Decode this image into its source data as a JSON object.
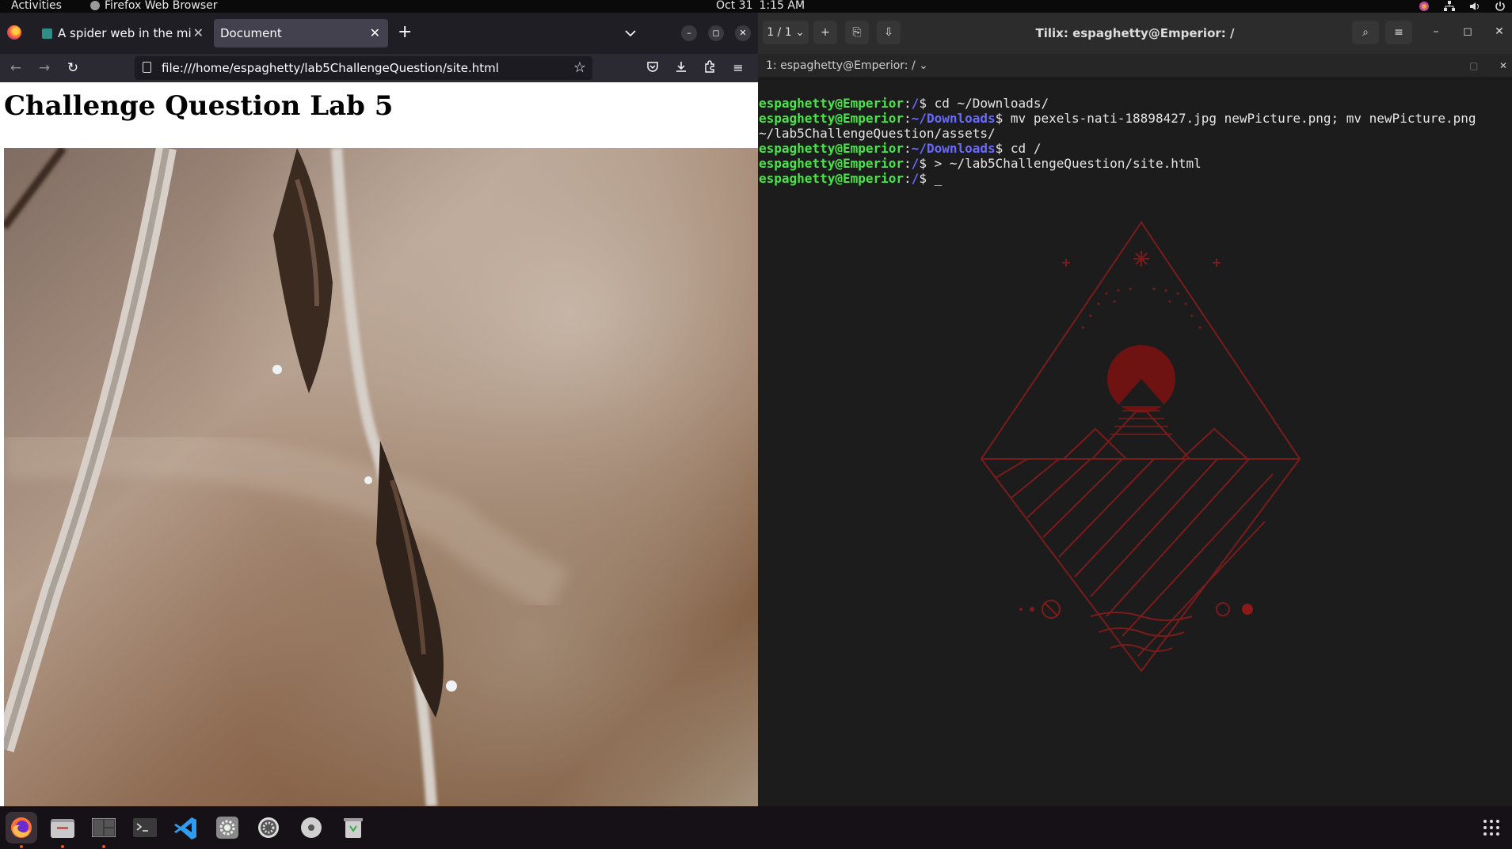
{
  "topbar": {
    "activities": "Activities",
    "app_name": "Firefox Web Browser",
    "date": "Oct 31",
    "time": "1:15 AM"
  },
  "firefox": {
    "tabs": [
      {
        "title": "A spider web in the midd",
        "active": false
      },
      {
        "title": "Document",
        "active": true
      }
    ],
    "url": "file:///home/espaghetty/lab5ChallengeQuestion/site.html",
    "page_heading": "Challenge Question Lab 5"
  },
  "tilix": {
    "title": "Tilix: espaghetty@Emperior: /",
    "session_counter": "1 / 1",
    "terminal_tab": "1: espaghetty@Emperior: /",
    "lines": [
      {
        "user": "espaghetty@Emperior",
        "path": "/",
        "cmd": " cd ~/Downloads/"
      },
      {
        "user": "espaghetty@Emperior",
        "path": "~/Downloads",
        "cmd": " mv pexels-nati-18898427.jpg newPicture.png; mv newPicture.png"
      },
      {
        "plain": "~/lab5ChallengeQuestion/assets/"
      },
      {
        "user": "espaghetty@Emperior",
        "path": "~/Downloads",
        "cmd": " cd /"
      },
      {
        "user": "espaghetty@Emperior",
        "path": "/",
        "cmd": " > ~/lab5ChallengeQuestion/site.html"
      },
      {
        "user": "espaghetty@Emperior",
        "path": "/",
        "cmd": " _"
      }
    ]
  },
  "dock": {
    "apps": [
      "firefox-icon",
      "files-icon",
      "tilix-icon",
      "terminal-icon",
      "vscode-icon",
      "settings-icon",
      "system-settings-icon",
      "disc-icon",
      "trash-icon"
    ]
  },
  "colors": {
    "prompt_user": "#4ae34a",
    "prompt_path": "#6a6aff",
    "art_red": "#8b1a1a",
    "firefox_accent": "#ff7139"
  }
}
